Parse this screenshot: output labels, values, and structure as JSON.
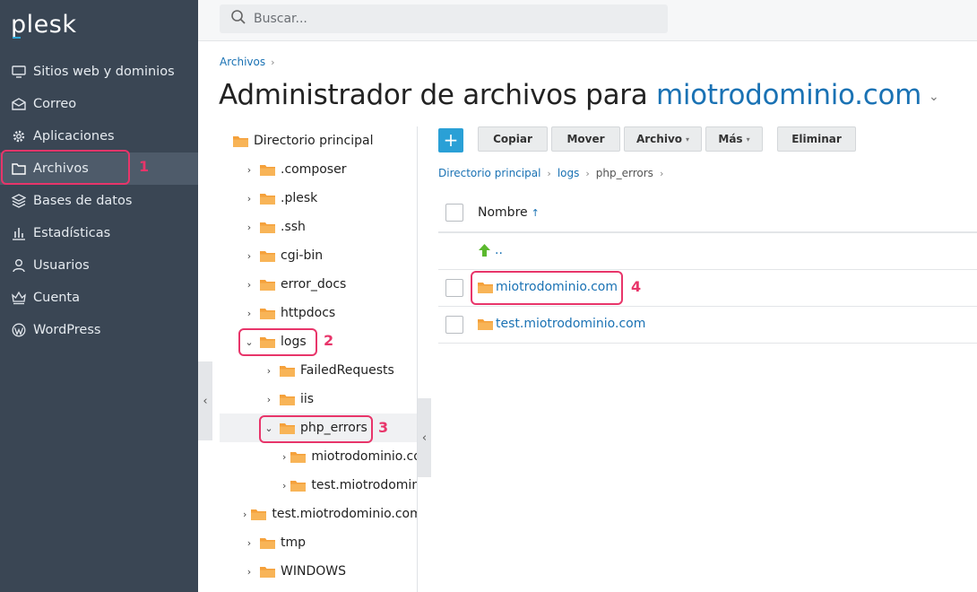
{
  "brand": {
    "logo": "plesk",
    "accent": "#2ea8d8"
  },
  "colors": {
    "sidebar_bg": "#3a4654",
    "link": "#1a72b4",
    "highlight": "#e8356a",
    "folder": "#f5a13b",
    "add_button": "#2aa0d6"
  },
  "search": {
    "placeholder": "Buscar...",
    "icon": "search-icon"
  },
  "sidebar": {
    "items": [
      {
        "label": "Sitios web y dominios",
        "icon": "monitor-icon"
      },
      {
        "label": "Correo",
        "icon": "mail-icon"
      },
      {
        "label": "Aplicaciones",
        "icon": "gear-icon"
      },
      {
        "label": "Archivos",
        "icon": "folder-icon",
        "active": true
      },
      {
        "label": "Bases de datos",
        "icon": "database-icon"
      },
      {
        "label": "Estadísticas",
        "icon": "chart-icon"
      },
      {
        "label": "Usuarios",
        "icon": "user-icon"
      },
      {
        "label": "Cuenta",
        "icon": "crown-icon"
      },
      {
        "label": "WordPress",
        "icon": "wordpress-icon"
      }
    ]
  },
  "annotations": {
    "n1": "1",
    "n2": "2",
    "n3": "3",
    "n4": "4"
  },
  "breadcrumb": {
    "root": "Archivos"
  },
  "title": {
    "prefix": "Administrador de archivos para ",
    "domain": "miotrodominio.com"
  },
  "tree": {
    "root": "Directorio principal",
    "nodes": [
      {
        "label": ".composer"
      },
      {
        "label": ".plesk"
      },
      {
        "label": ".ssh"
      },
      {
        "label": "cgi-bin"
      },
      {
        "label": "error_docs"
      },
      {
        "label": "httpdocs"
      },
      {
        "label": "logs",
        "expanded": true
      },
      {
        "label": "FailedRequests"
      },
      {
        "label": "iis"
      },
      {
        "label": "php_errors",
        "expanded": true,
        "selected": true
      },
      {
        "label": "miotrodominio.com"
      },
      {
        "label": "test.miotrodominio.com"
      },
      {
        "label": "test.miotrodominio.com"
      },
      {
        "label": "tmp"
      },
      {
        "label": "WINDOWS"
      }
    ]
  },
  "toolbar": {
    "add": "+",
    "copy": "Copiar",
    "move": "Mover",
    "file": "Archivo",
    "more": "Más",
    "delete": "Eliminar"
  },
  "path": {
    "home": "Directorio principal",
    "logs": "logs",
    "current": "php_errors"
  },
  "list": {
    "header": "Nombre",
    "sort_indicator": "↑",
    "parent": "..",
    "rows": [
      {
        "name": "miotrodominio.com"
      },
      {
        "name": "test.miotrodominio.com"
      }
    ]
  }
}
